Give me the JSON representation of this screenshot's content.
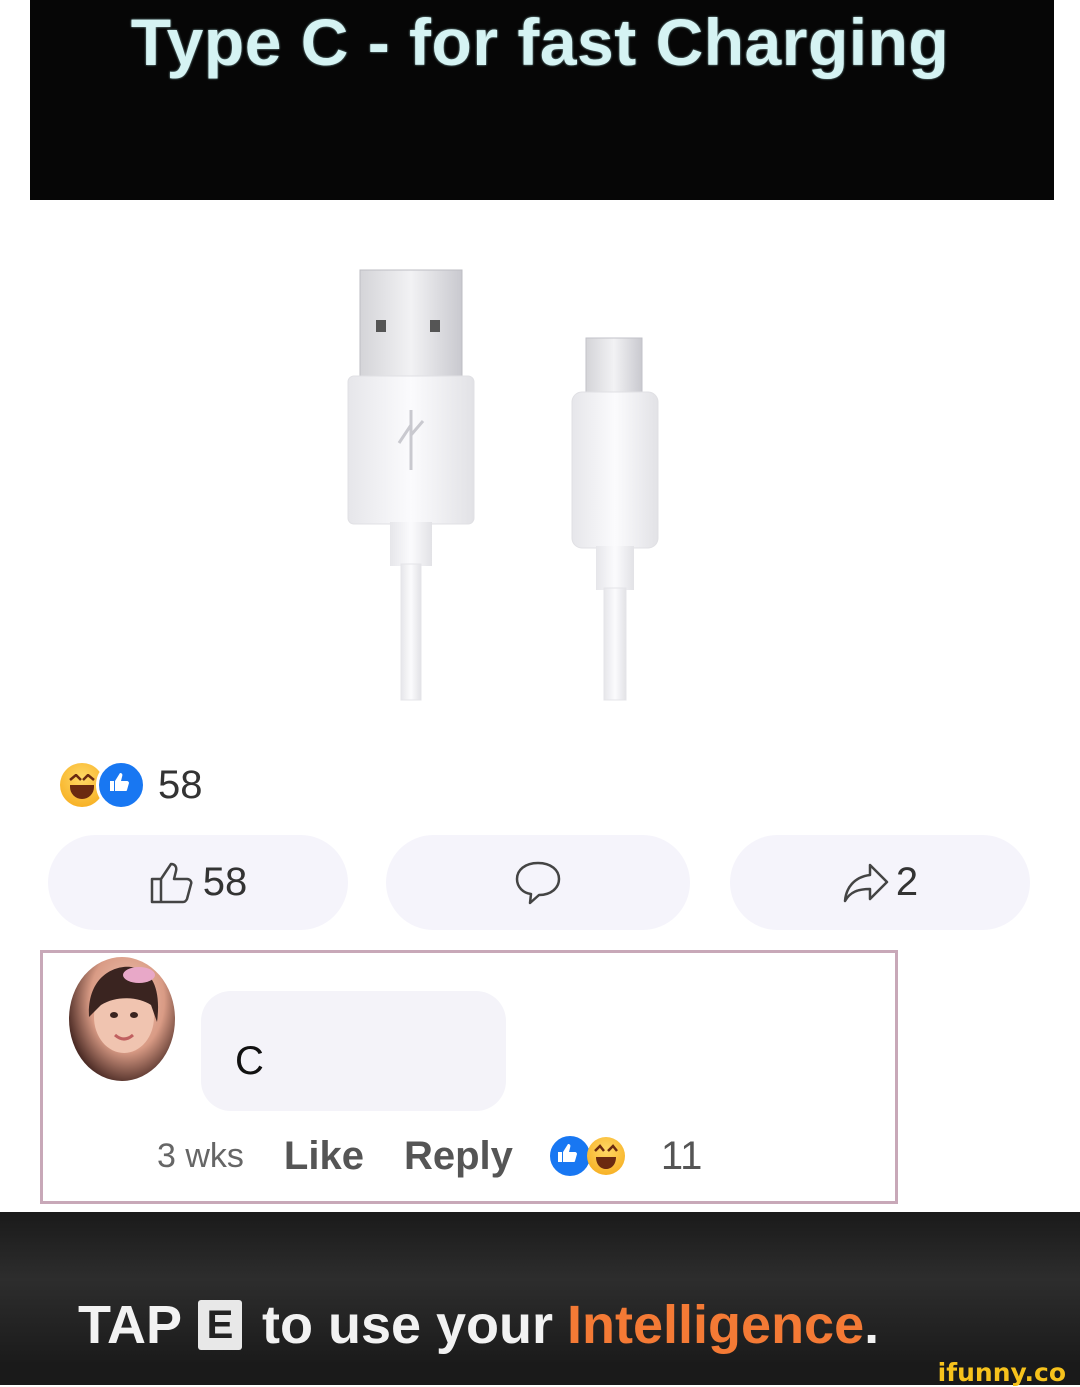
{
  "headline": "Type C - for fast Charging",
  "reactions": {
    "summary_count": "58",
    "icons": [
      "haha-emoji-icon",
      "like-emoji-icon"
    ]
  },
  "actions": {
    "like_count": "58",
    "share_count": "2"
  },
  "comment": {
    "text": "C",
    "time": "3 wks",
    "like_label": "Like",
    "reply_label": "Reply",
    "reaction_count": "11"
  },
  "caption": {
    "tap": "TAP",
    "key": "E",
    "middle": "to use your",
    "highlight": "Intelligence",
    "period": "."
  },
  "watermark": "ifunny.co",
  "colors": {
    "banner_bg": "#060606",
    "headline": "#d5f3f3",
    "like_blue": "#1877f2",
    "highlight_orange": "#f47a35",
    "watermark_yellow": "#f6c21c"
  }
}
